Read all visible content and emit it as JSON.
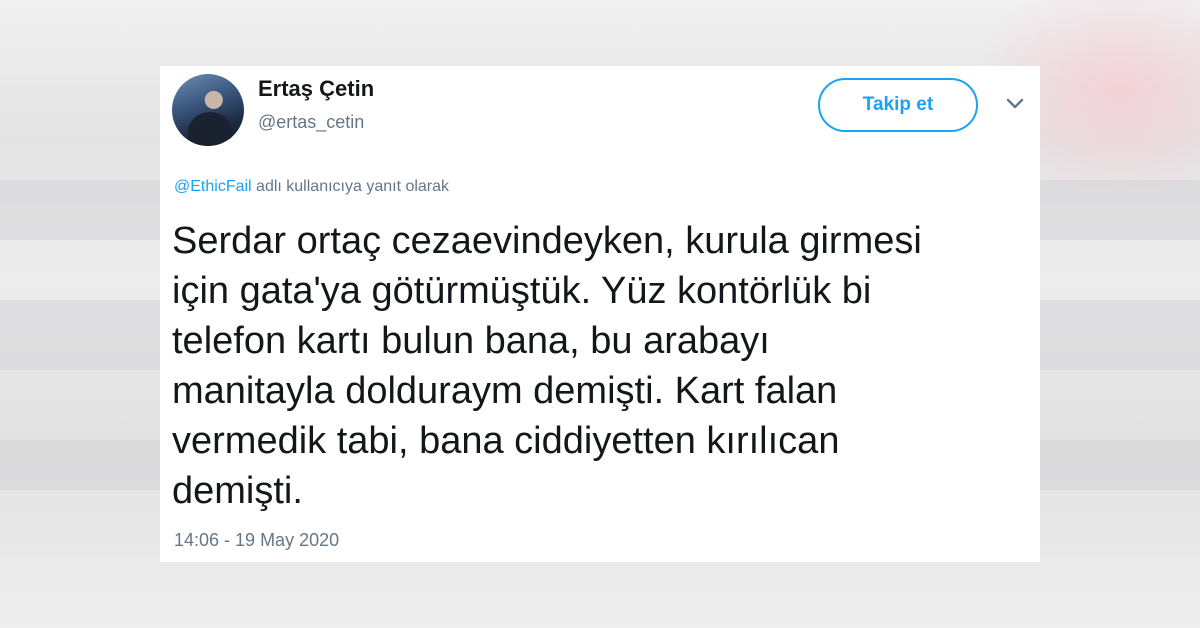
{
  "tweet": {
    "author": {
      "display_name": "Ertaş Çetin",
      "handle": "@ertas_cetin"
    },
    "follow_label": "Takip et",
    "reply_to": {
      "mention": "@EthicFail",
      "suffix": " adlı kullanıcıya yanıt olarak"
    },
    "text_lines": [
      "Serdar ortaç cezaevindeyken, kurula girmesi",
      "için gata'ya götürmüştük. Yüz kontörlük bi",
      "telefon kartı bulun bana, bu arabayı",
      "manitayla dolduraym demişti. Kart falan",
      "vermedik tabi, bana ciddiyetten kırılıcan",
      "demişti."
    ],
    "timestamp": "14:06 - 19 May 2020"
  },
  "colors": {
    "accent": "#1da1f2",
    "text_primary": "#14171a",
    "text_secondary": "#657786"
  },
  "icons": {
    "menu": "chevron-down-icon",
    "avatar": "avatar"
  }
}
